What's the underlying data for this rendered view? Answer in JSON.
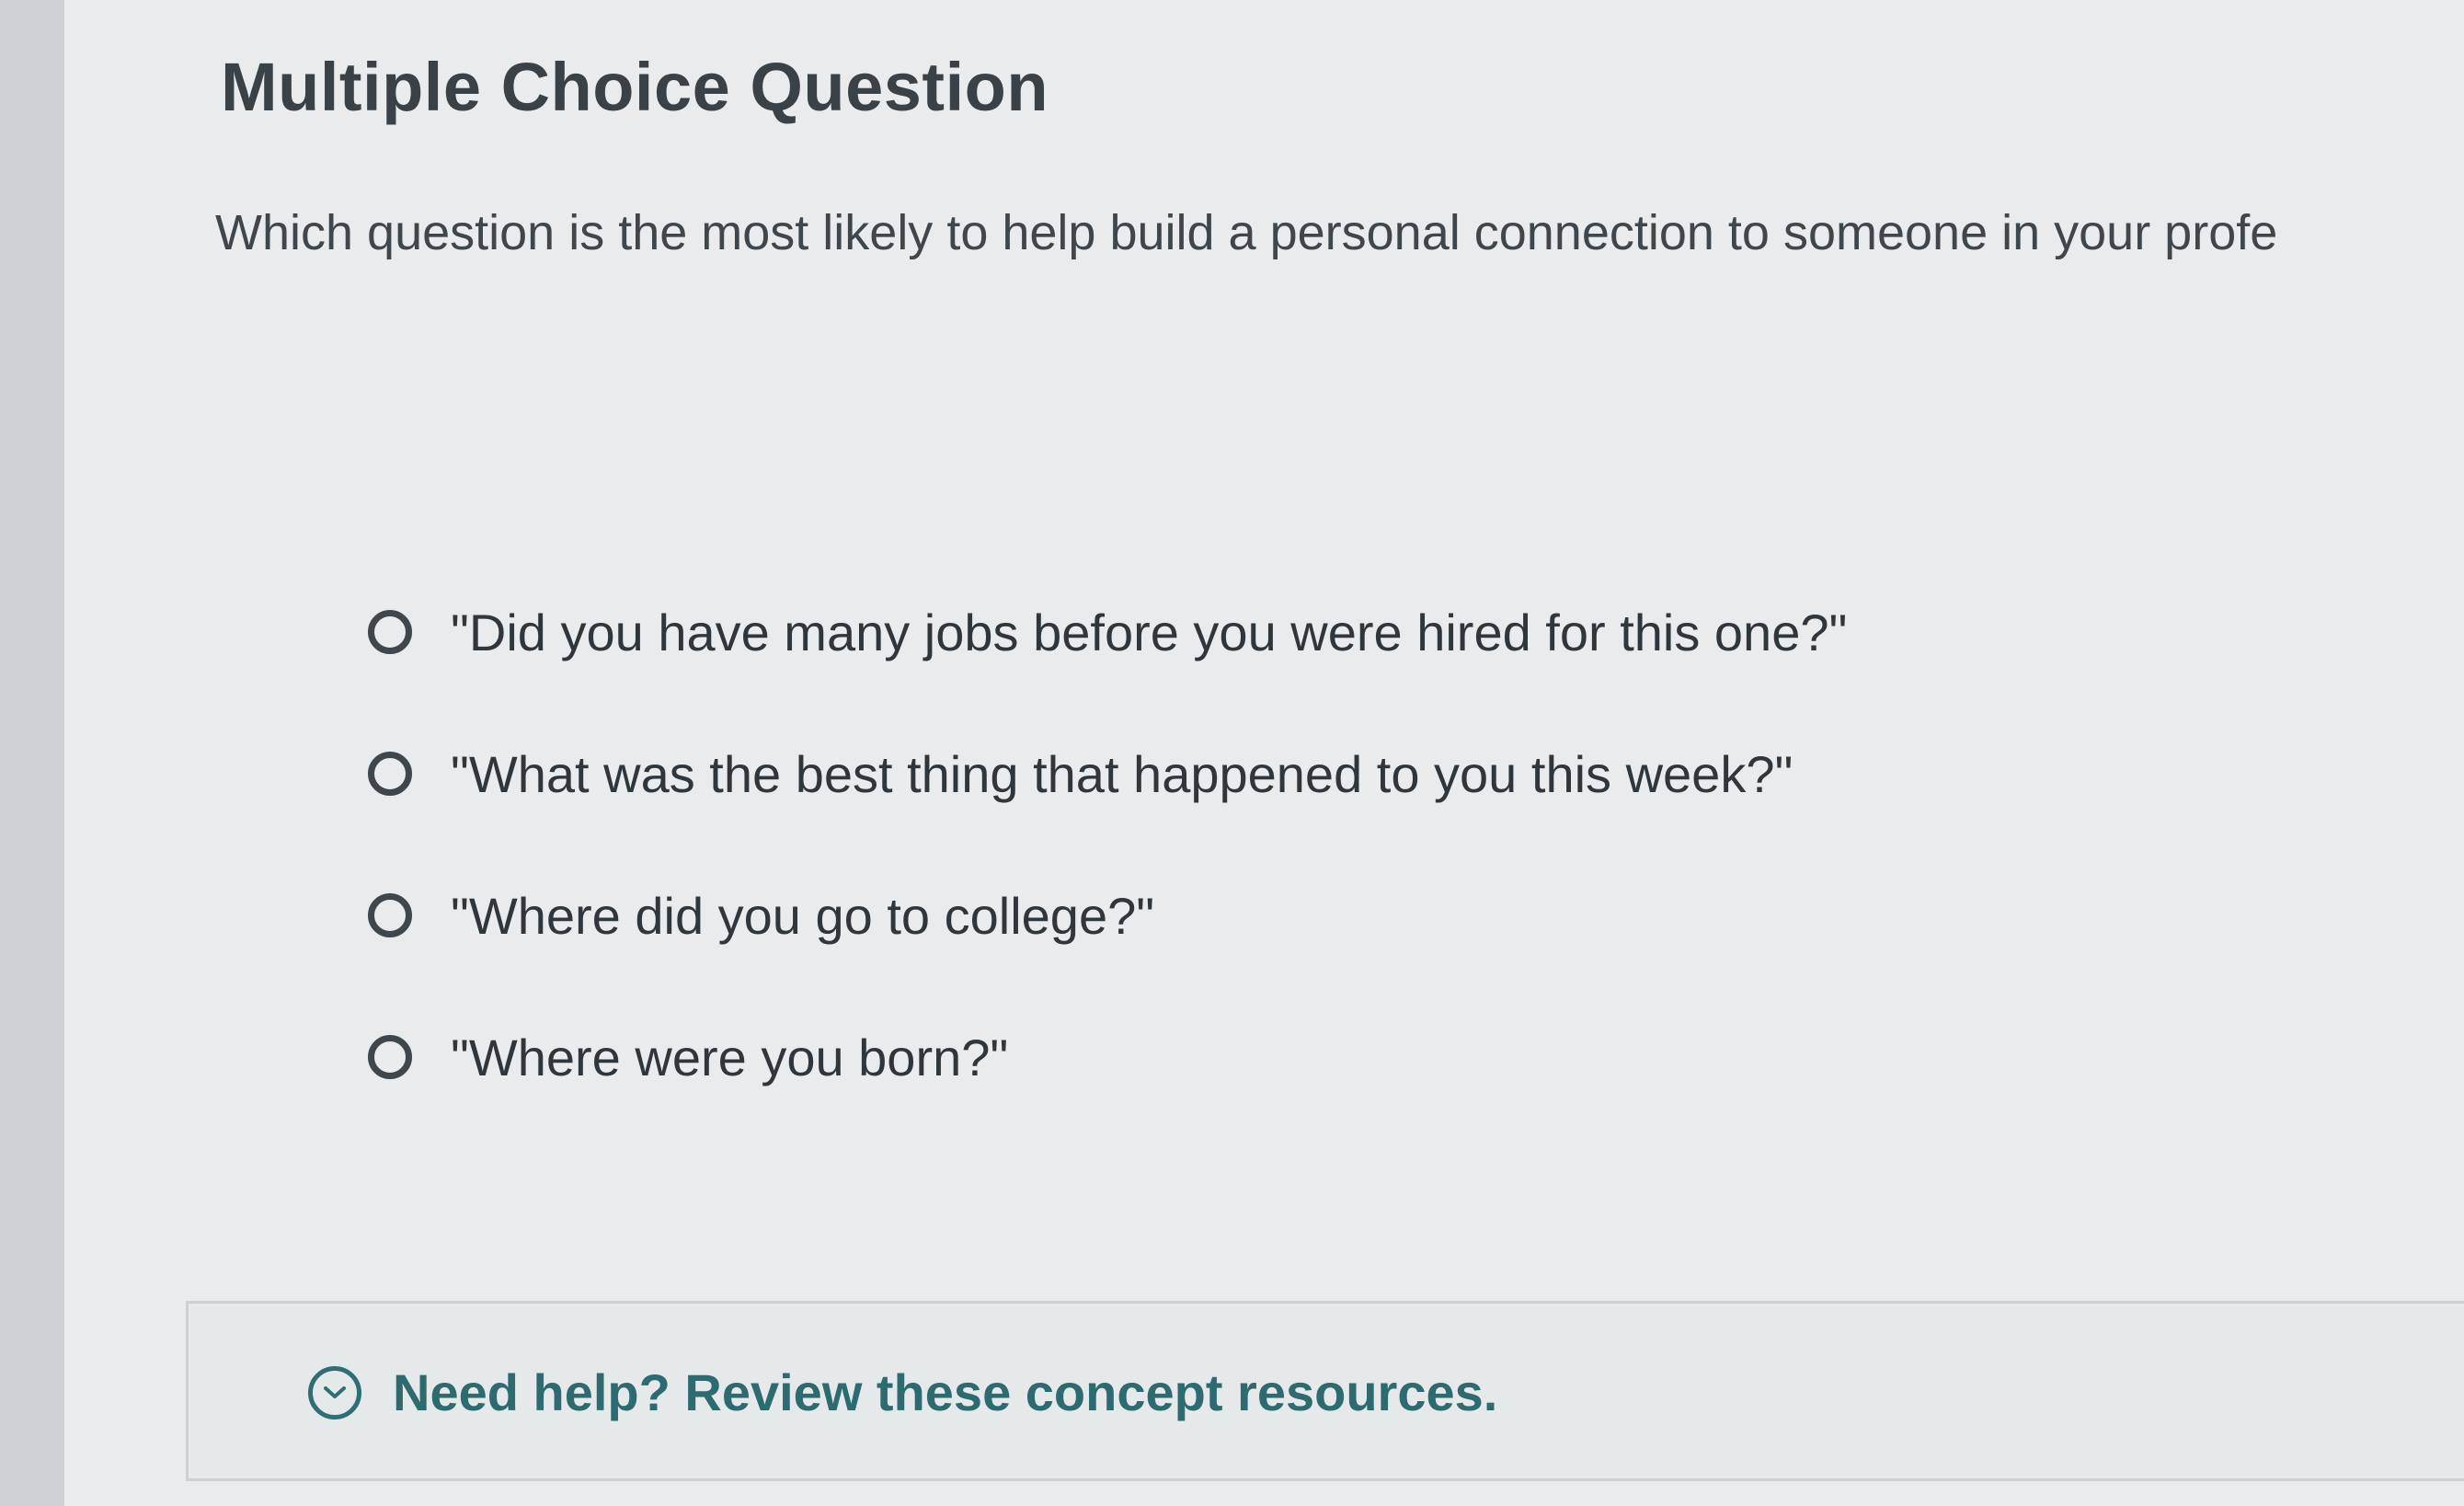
{
  "page": {
    "title": "Multiple Choice Question",
    "prompt": "Which question is the most likely to help build a personal connection to someone in your profe"
  },
  "choices": [
    {
      "label": "\"Did you have many jobs before you were hired for this one?\""
    },
    {
      "label": "\"What was the best thing that happened to you this week?\""
    },
    {
      "label": "\"Where did you go to college?\""
    },
    {
      "label": "\"Where were you born?\""
    }
  ],
  "help": {
    "link_text": "Need help? Review these concept resources.",
    "icon": "chevron-down-circle-icon"
  },
  "colors": {
    "accent": "#2d6b71",
    "text": "#333a3f"
  }
}
